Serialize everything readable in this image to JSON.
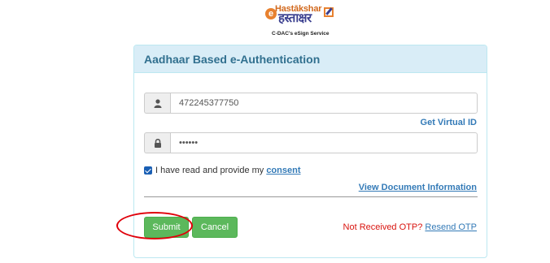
{
  "logo": {
    "text_top": "Hastākshar",
    "text_hindi": "हस्ताक्षर",
    "subtitle": "C-DAC's eSign Service",
    "icon_name": "hastakshar-logo"
  },
  "panel": {
    "title": "Aadhaar Based e-Authentication"
  },
  "aadhaar": {
    "value": "472245377750",
    "icon": "user-icon"
  },
  "otp": {
    "value": "••••••",
    "icon": "lock-icon"
  },
  "links": {
    "get_virtual_id": "Get Virtual ID",
    "view_document": "View Document Information"
  },
  "consent": {
    "text": "I have read and provide my",
    "link": "consent",
    "checked": true
  },
  "buttons": {
    "submit": "Submit",
    "cancel": "Cancel"
  },
  "otp_resend": {
    "prompt": "Not Received OTP?",
    "link": "Resend OTP"
  },
  "colors": {
    "panel_heading_bg": "#d9edf7",
    "panel_title": "#31708f",
    "button_green": "#5cb85c",
    "link_blue": "#337ab7",
    "warning_red": "#d9140f",
    "annotation_red": "#e0000a"
  }
}
